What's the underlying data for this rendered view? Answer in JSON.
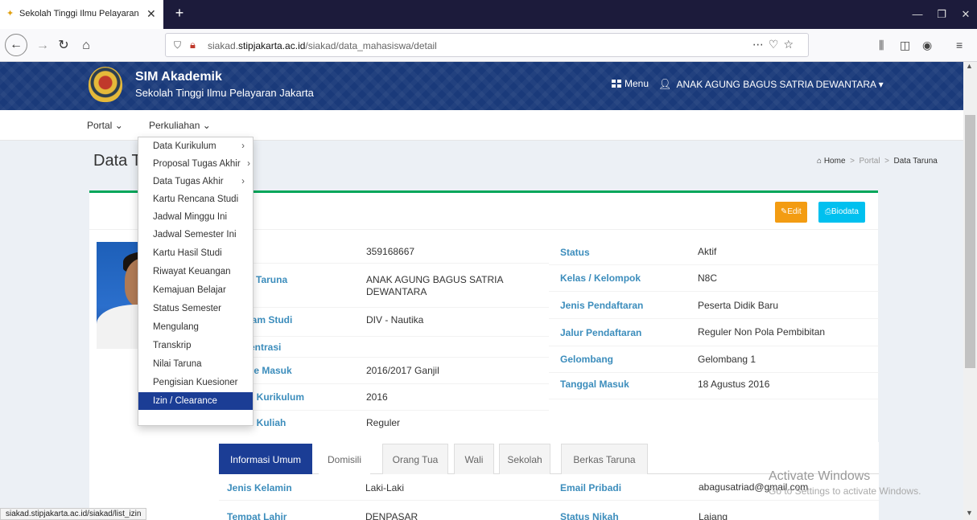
{
  "browser": {
    "tab_title": "Sekolah Tinggi Ilmu Pelayaran Jakarta",
    "url_prefix": "siakad.",
    "url_domain": "stipjakarta.ac.id",
    "url_path": "/siakad/data_mahasiswa/detail",
    "status_url": "siakad.stipjakarta.ac.id/siakad/list_izin"
  },
  "header": {
    "title": "SIM Akademik",
    "subtitle": "Sekolah Tinggi Ilmu Pelayaran Jakarta",
    "menu_label": "Menu",
    "user_name": "ANAK AGUNG BAGUS SATRIA DEWANTARA"
  },
  "nav": {
    "portal": "Portal",
    "perkuliahan": "Perkuliahan"
  },
  "dropdown": {
    "items": [
      {
        "label": "Data Kurikulum",
        "sub": true
      },
      {
        "label": "Proposal Tugas Akhir",
        "sub": true
      },
      {
        "label": "Data Tugas Akhir",
        "sub": true
      },
      {
        "label": "Kartu Rencana Studi",
        "sub": false
      },
      {
        "label": "Jadwal Minggu Ini",
        "sub": false
      },
      {
        "label": "Jadwal Semester Ini",
        "sub": false
      },
      {
        "label": "Kartu Hasil Studi",
        "sub": false
      },
      {
        "label": "Riwayat Keuangan",
        "sub": false
      },
      {
        "label": "Kemajuan Belajar",
        "sub": false
      },
      {
        "label": "Status Semester",
        "sub": false
      },
      {
        "label": "Mengulang",
        "sub": false
      },
      {
        "label": "Transkrip",
        "sub": false
      },
      {
        "label": "Nilai Taruna",
        "sub": false
      },
      {
        "label": "Pengisian Kuesioner",
        "sub": false
      },
      {
        "label": "Izin / Clearance",
        "sub": false,
        "active": true
      }
    ]
  },
  "page": {
    "title": "Data T",
    "breadcrumb_home": "Home",
    "breadcrumb_portal": "Portal",
    "breadcrumb_current": "Data Taruna",
    "edit_label": "Edit",
    "biodata_label": "Biodata"
  },
  "details_left": [
    {
      "label": "",
      "value": "359168667"
    },
    {
      "label": "a Taruna",
      "value": "ANAK AGUNG BAGUS SATRIA DEWANTARA"
    },
    {
      "label": "ram Studi",
      "value": "DIV - Nautika"
    },
    {
      "label": "entrasi",
      "value": ""
    },
    {
      "label": "de Masuk",
      "value": "2016/2017 Ganjil"
    },
    {
      "label": "n Kurikulum",
      "value": "2016"
    },
    {
      "label": "...n Kuliah",
      "value": "Reguler"
    }
  ],
  "details_right": [
    {
      "label": "Status",
      "value": "Aktif"
    },
    {
      "label": "Kelas / Kelompok",
      "value": "N8C"
    },
    {
      "label": "Jenis Pendaftaran",
      "value": "Peserta Didik Baru"
    },
    {
      "label": "Jalur Pendaftaran",
      "value": "Reguler Non Pola Pembibitan"
    },
    {
      "label": "Gelombang",
      "value": "Gelombang 1"
    },
    {
      "label": "Tanggal Masuk",
      "value": "18 Agustus 2016"
    }
  ],
  "tabs": [
    "Informasi Umum",
    "Domisili",
    "Orang Tua",
    "Wali",
    "Sekolah",
    "Berkas Taruna"
  ],
  "info": {
    "row1": {
      "l1": "Jenis Kelamin",
      "v1": "Laki-Laki",
      "l2": "Email Pribadi",
      "v2": "abagusatriad@gmail.com"
    },
    "row2": {
      "l1": "Tempat Lahir",
      "v1": "DENPASAR",
      "l2": "Status Nikah",
      "v2": "Lajang"
    }
  },
  "watermark": {
    "line1": "Activate Windows",
    "line2": "Go to Settings to activate Windows."
  },
  "colors": {
    "header_bg": "#1a3a7a",
    "link": "#3c8dbc",
    "edit": "#f39c12",
    "biodata": "#00c0ef",
    "active_tab": "#1b3d95",
    "box_top": "#00a65a"
  }
}
